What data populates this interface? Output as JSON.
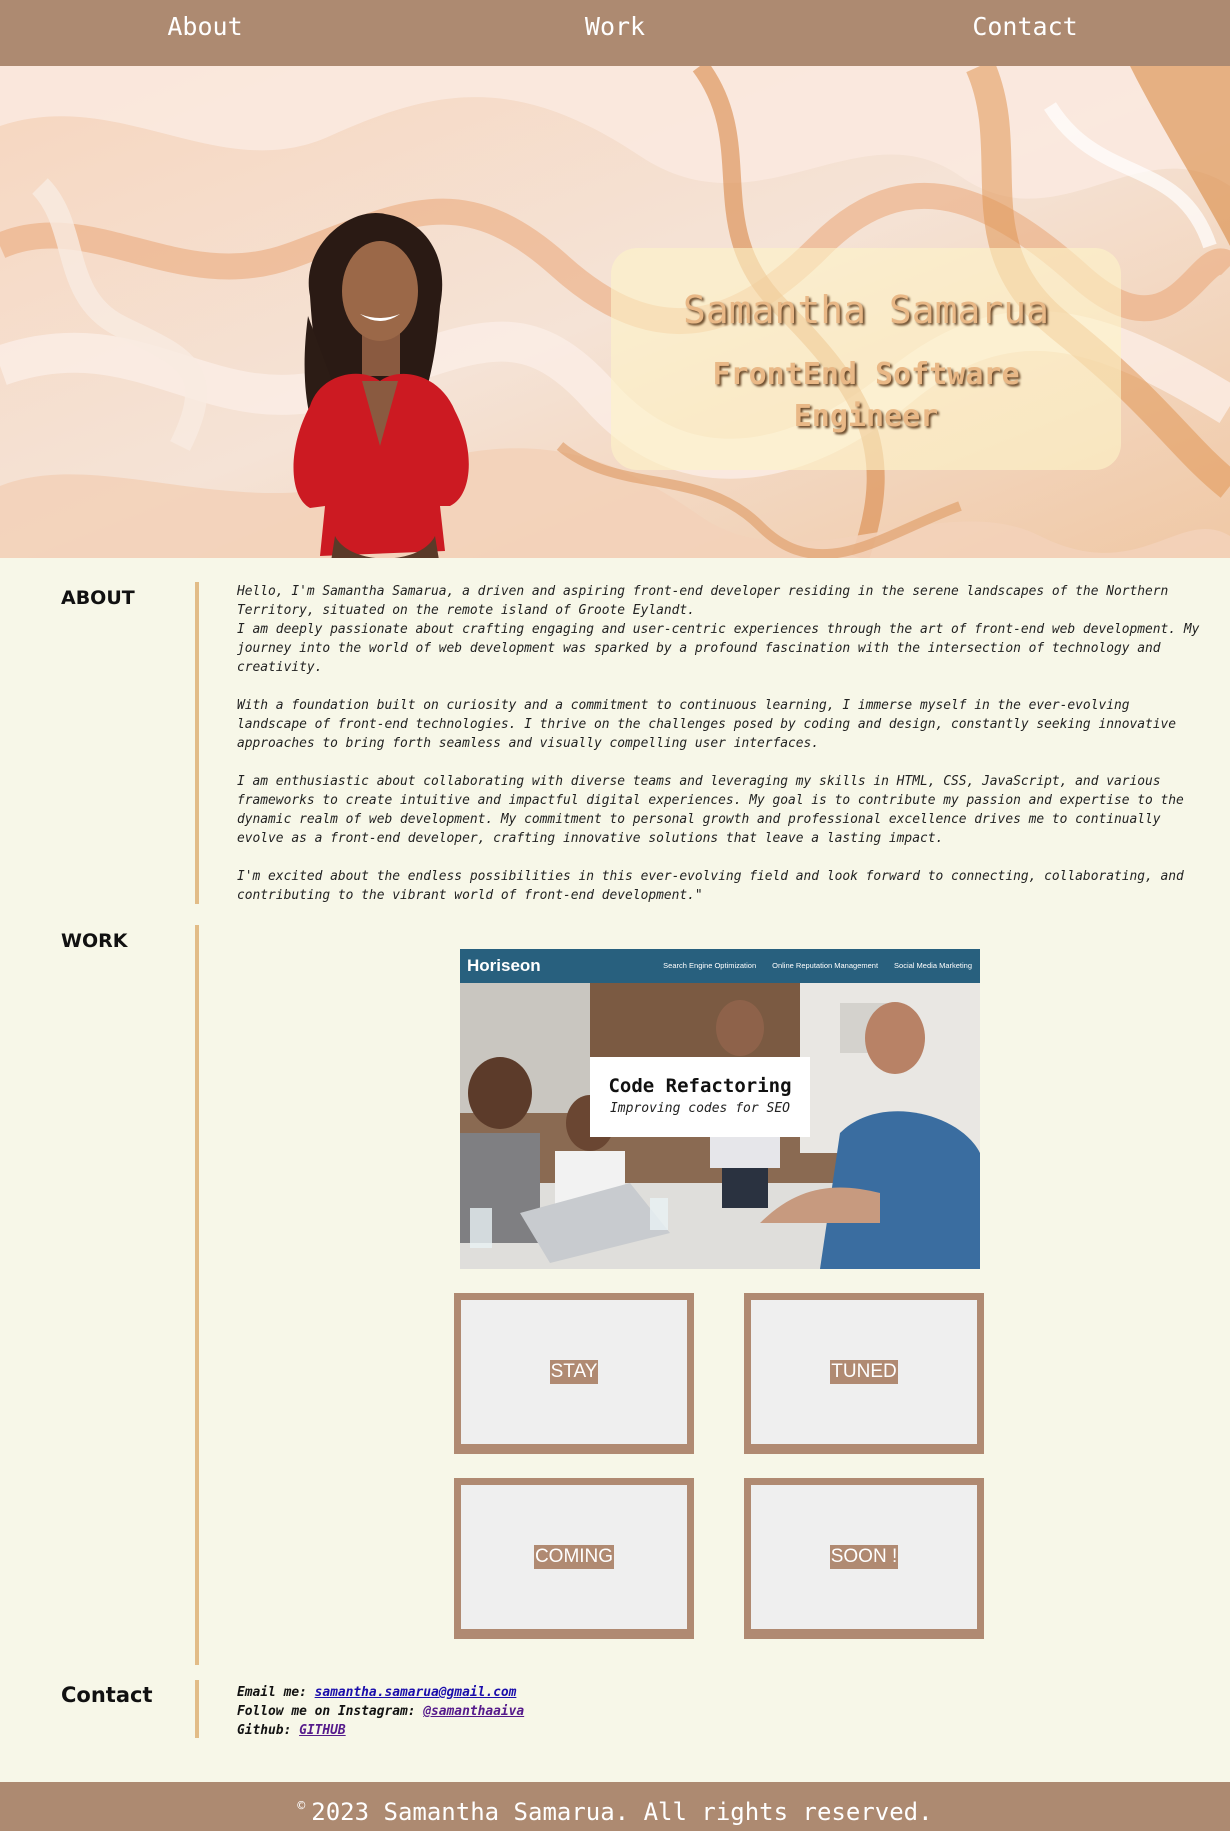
{
  "nav": {
    "items": [
      {
        "label": "About"
      },
      {
        "label": "Work"
      },
      {
        "label": "Contact"
      }
    ]
  },
  "hero": {
    "name": "Samantha Samarua",
    "role": "FrontEnd Software Engineer"
  },
  "about": {
    "heading": "ABOUT",
    "paragraphs": [
      "Hello, I'm Samantha Samarua, a driven and aspiring front-end developer residing in the serene landscapes of the Northern Territory, situated on the remote island of Groote Eylandt.\nI am deeply passionate about crafting engaging and user-centric experiences through the art of front-end web development. My journey into the world of web development was sparked by a profound fascination with the intersection of technology and creativity.",
      "With a foundation built on curiosity and a commitment to continuous learning, I immerse myself in the ever-evolving landscape of front-end technologies. I thrive on the challenges posed by coding and design, constantly seeking innovative approaches to bring forth seamless and visually compelling user interfaces.",
      "I am enthusiastic about collaborating with diverse teams and leveraging my skills in HTML, CSS, JavaScript, and various frameworks to create intuitive and impactful digital experiences. My goal is to contribute my passion and expertise to the dynamic realm of web development. My commitment to personal growth and professional excellence drives me to continually evolve as a front-end developer, crafting innovative solutions that leave a lasting impact.",
      "I'm excited about the endless possibilities in this ever-evolving field and look forward to connecting, collaborating, and contributing to the vibrant world of front-end development.\""
    ]
  },
  "work": {
    "heading": "WORK",
    "project": {
      "brand": "Horiseon",
      "nav": [
        "Search Engine Optimization",
        "Online Reputation Management",
        "Social Media Marketing"
      ],
      "title": "Code Refactoring",
      "subtitle": "Improving codes for SEO"
    },
    "tiles": [
      "STAY",
      "TUNED",
      "COMING",
      "SOON !"
    ]
  },
  "contact": {
    "heading": "Contact",
    "email_label": "Email me: ",
    "email": "samantha.samarua@gmail.com",
    "instagram_label": "Follow me on Instagram: ",
    "instagram": "@samanthaaiva",
    "github_label": "Github: ",
    "github": "GITHUB"
  },
  "footer": {
    "symbol": "©",
    "text": "2023 Samantha Samarua. All rights reserved."
  },
  "colors": {
    "nav_bg": "#ad8a71",
    "page_bg": "#f7f7e8",
    "accent_rule": "#e2bc87",
    "tile_border": "#b08a72"
  }
}
